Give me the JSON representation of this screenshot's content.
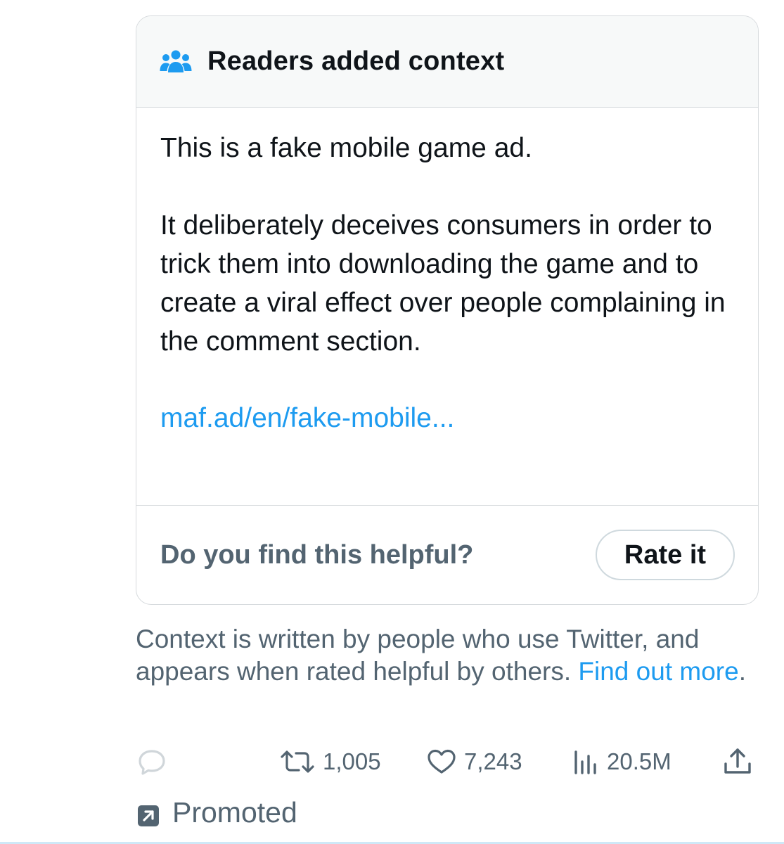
{
  "note": {
    "header_title": "Readers added context",
    "header_icon": "people-icon",
    "paragraph_1": "This is a fake mobile game ad.",
    "paragraph_2": "It deliberately deceives consumers in order to trick them into downloading the game and to create a viral effect over people complaining in the comment section.",
    "link_text": "maf.ad/en/fake-mobile...",
    "helpful_question": "Do you find this helpful?",
    "rate_button_label": "Rate it"
  },
  "disclaimer": {
    "text": "Context is written by people who use Twitter, and appears when rated helpful by others. ",
    "link_text": "Find out more",
    "suffix": "."
  },
  "actions": {
    "reply_icon": "reply-icon",
    "retweet_count": "1,005",
    "like_count": "7,243",
    "views_count": "20.5M",
    "share_icon": "share-icon"
  },
  "promoted": {
    "label": "Promoted",
    "icon": "promoted-arrow-icon"
  },
  "colors": {
    "accent": "#1d9bf0",
    "secondary_text": "#536471",
    "primary_text": "#0f1419",
    "border": "#d6dadd",
    "header_bg": "#f7f9f9"
  }
}
